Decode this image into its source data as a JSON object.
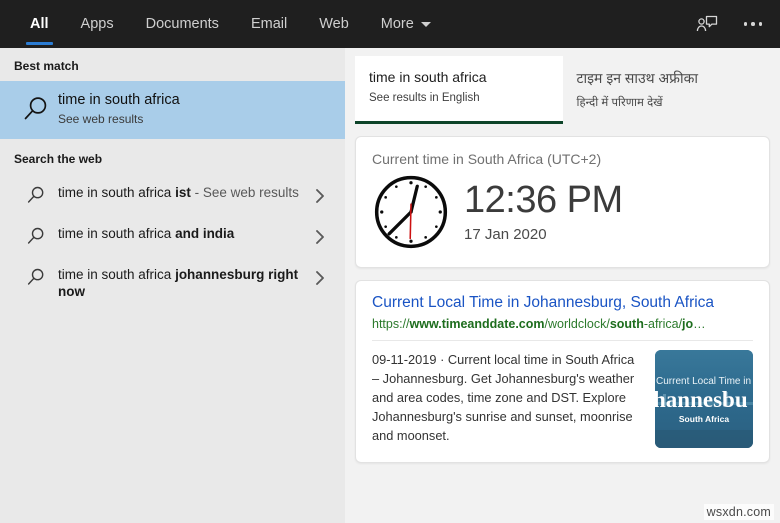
{
  "header": {
    "tabs": [
      {
        "label": "All",
        "active": true
      },
      {
        "label": "Apps",
        "active": false
      },
      {
        "label": "Documents",
        "active": false
      },
      {
        "label": "Email",
        "active": false
      },
      {
        "label": "Web",
        "active": false
      },
      {
        "label": "More",
        "active": false,
        "has_caret": true
      }
    ],
    "feedback_icon": "person-feedback-icon",
    "more_options_icon": "more-options-icon",
    "active_underline_color": "#2b7cd3",
    "background_color": "#1f1f1f"
  },
  "left_panel": {
    "best_match_heading": "Best match",
    "best_match": {
      "icon": "search-icon",
      "title": "time in south africa",
      "subtitle": "See web results",
      "highlight_color": "#a9cde9"
    },
    "search_web_heading": "Search the web",
    "suggestions": [
      {
        "icon": "search-icon",
        "prefix": "time in south africa ",
        "bold": "ist",
        "suffix": " - See web results",
        "chevron": "chevron-right-icon"
      },
      {
        "icon": "search-icon",
        "prefix": "time in south africa ",
        "bold": "and india",
        "suffix": "",
        "chevron": "chevron-right-icon"
      },
      {
        "icon": "search-icon",
        "prefix": "time in south africa ",
        "bold": "johannesburg right now",
        "suffix": "",
        "chevron": "chevron-right-icon"
      }
    ]
  },
  "right_panel": {
    "language_tabs": [
      {
        "title": "time in south africa",
        "subtitle": "See results in English",
        "active": true,
        "underline_color": "#0d4429"
      },
      {
        "title": "टाइम इन साउथ अफ्रीका",
        "subtitle": "हिन्दी में परिणाम देखें",
        "active": false
      }
    ],
    "clock_card": {
      "heading": "Current time in South Africa (UTC+2)",
      "time": "12:36 PM",
      "date": "17 Jan 2020",
      "clock_icon": "analog-clock-icon",
      "second_hand_color": "#cc1111"
    },
    "web_result": {
      "title": "Current Local Time in Johannesburg, South Africa",
      "url_parts": [
        {
          "text": "https://",
          "bold": false
        },
        {
          "text": "www.timeanddate.com",
          "bold": true
        },
        {
          "text": "/worldclock/",
          "bold": false
        },
        {
          "text": "south",
          "bold": true
        },
        {
          "text": "-africa/",
          "bold": false
        },
        {
          "text": "jo",
          "bold": true
        },
        {
          "text": "…",
          "bold": false
        }
      ],
      "snippet": "09-11-2019 · Current local time in South Africa – Johannesburg. Get Johannesburg's weather and area codes, time zone and DST. Explore Johannesburg's sunrise and sunset, moonrise and moonset.",
      "thumbnail": {
        "line1": "Current Local Time in",
        "line2": "hannesbu",
        "line3": "South Africa",
        "background_color": "#2d6e92"
      }
    }
  },
  "watermark": "wsxdn.com"
}
